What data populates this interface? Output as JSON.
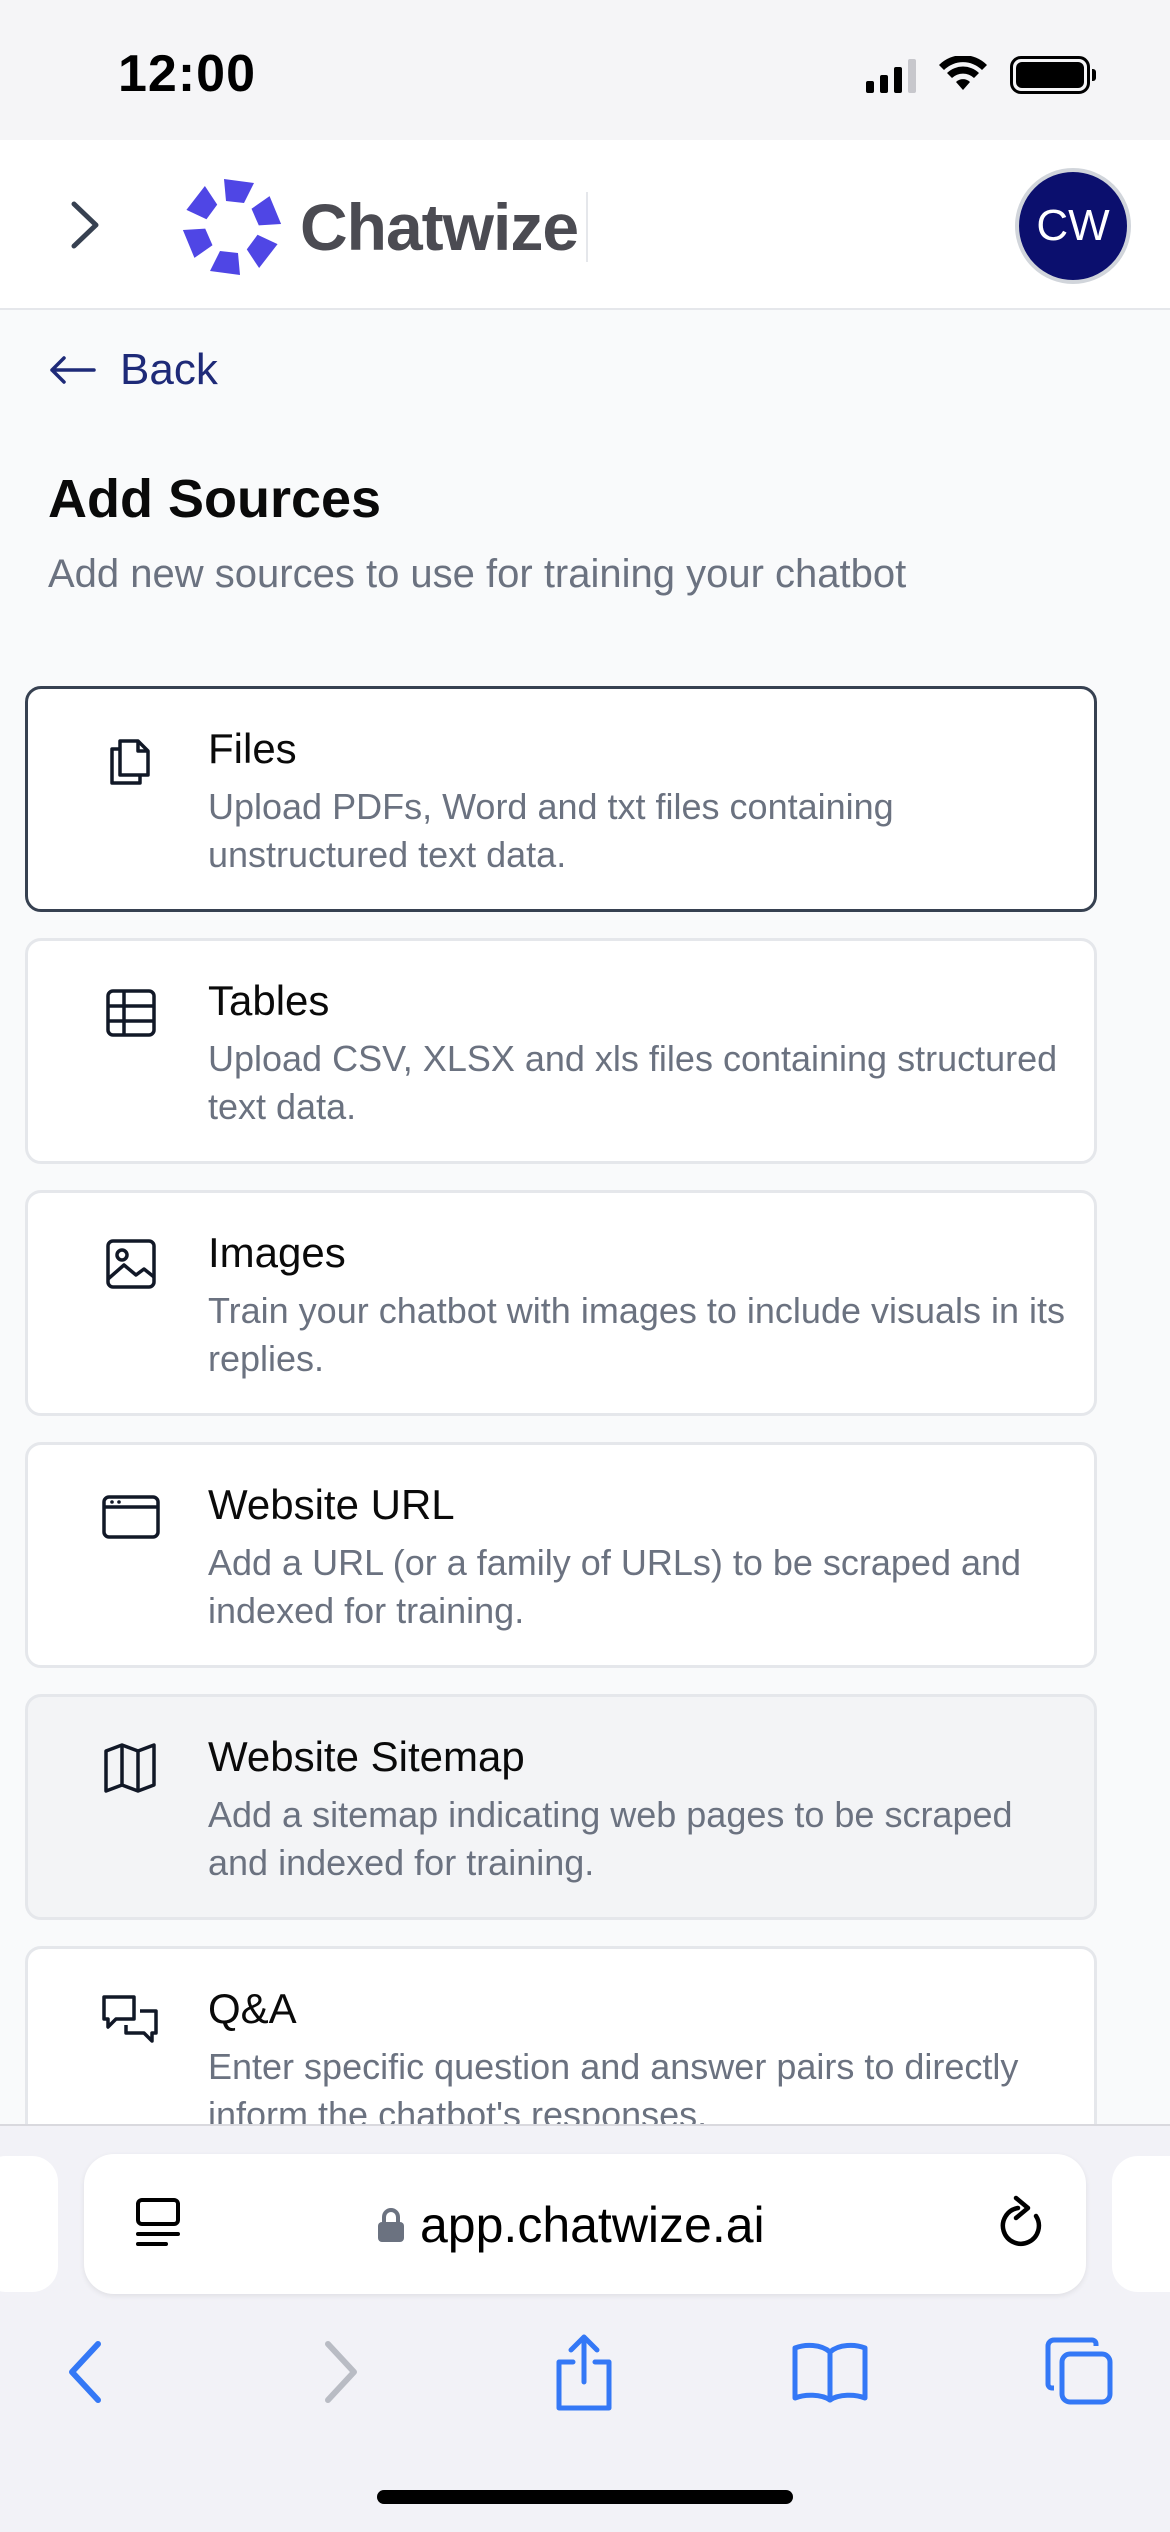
{
  "status_bar": {
    "time": "12:00"
  },
  "header": {
    "brand_name": "Chatwize",
    "avatar_initials": "CW",
    "brand_color": "#4f46e5"
  },
  "nav": {
    "back_label": "Back"
  },
  "page": {
    "title": "Add Sources",
    "subtitle": "Add new sources to use for training your chatbot"
  },
  "sources": [
    {
      "title": "Files",
      "description": "Upload PDFs, Word and txt files containing unstructured text data.",
      "icon": "files-icon"
    },
    {
      "title": "Tables",
      "description": "Upload CSV, XLSX and xls files containing structured text data.",
      "icon": "table-icon"
    },
    {
      "title": "Images",
      "description": "Train your chatbot with images to include visuals in its replies.",
      "icon": "image-icon"
    },
    {
      "title": "Website URL",
      "description": "Add a URL (or a family of URLs) to be scraped and indexed for training.",
      "icon": "browser-window-icon"
    },
    {
      "title": "Website Sitemap",
      "description": "Add a sitemap indicating web pages to be scraped and indexed for training.",
      "icon": "map-icon"
    },
    {
      "title": "Q&A",
      "description": "Enter specific question and answer pairs to directly inform the chatbot's responses.",
      "icon": "chat-bubbles-icon"
    }
  ],
  "browser": {
    "url": "app.chatwize.ai",
    "accent_color": "#3478f6"
  }
}
